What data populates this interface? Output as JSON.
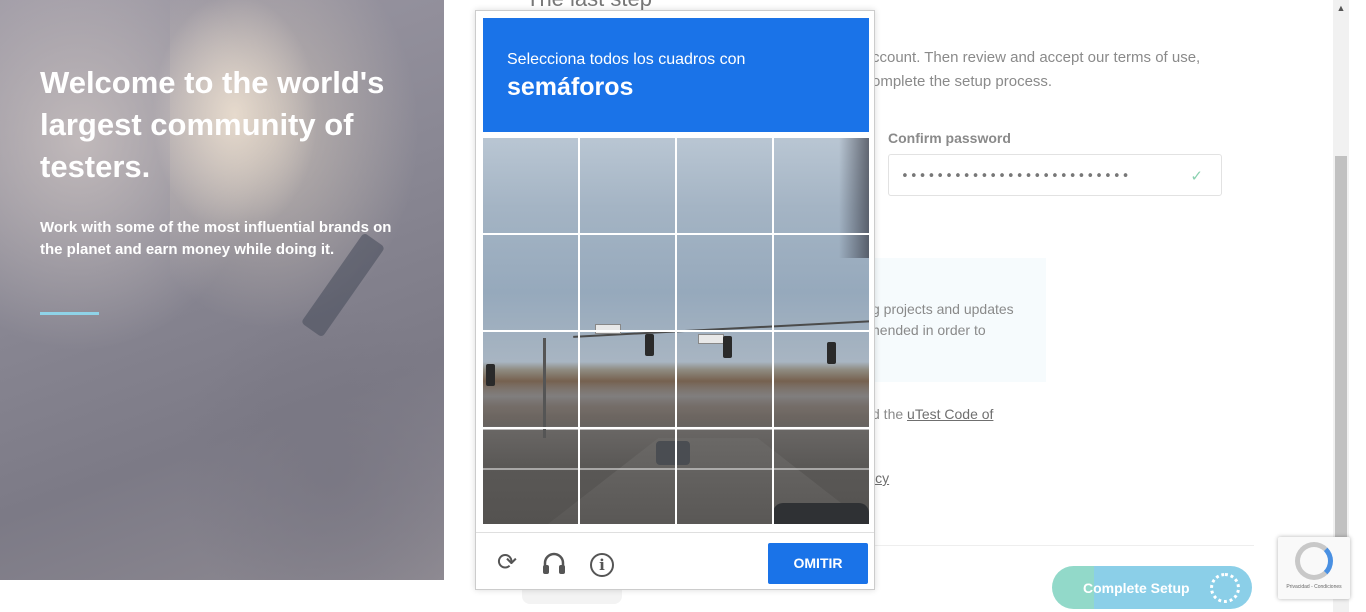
{
  "hero": {
    "title": "Welcome to the world's largest community of testers.",
    "subtitle": "Work with some of the most influential brands on the planet and earn money while doing it."
  },
  "form": {
    "title": "The last step",
    "desc_line1": "ccount. Then review and accept our terms of use,",
    "desc_line2": "omplete the setup process.",
    "confirm_label": "Confirm password",
    "confirm_value": "••••••••••••••••••••••••••",
    "info_line1": "g projects and updates",
    "info_line2": "nended in order to",
    "agree1_prefix": "d the ",
    "agree1_link": "uTest Code of",
    "agree2_link": "icy",
    "complete_label": "Complete Setup"
  },
  "captcha": {
    "instruction": "Selecciona todos los cuadros con",
    "target": "semáforos",
    "skip_label": "OMITIR",
    "icons": [
      "reload-icon",
      "headphones-icon",
      "info-icon"
    ],
    "badge_terms": "Privacidad - Condiciones"
  },
  "colors": {
    "captcha_blue": "#1a73e8",
    "complete_green": "#92d9c9",
    "complete_blue": "#8bcfe8",
    "hero_accent": "#8fd3e8"
  }
}
